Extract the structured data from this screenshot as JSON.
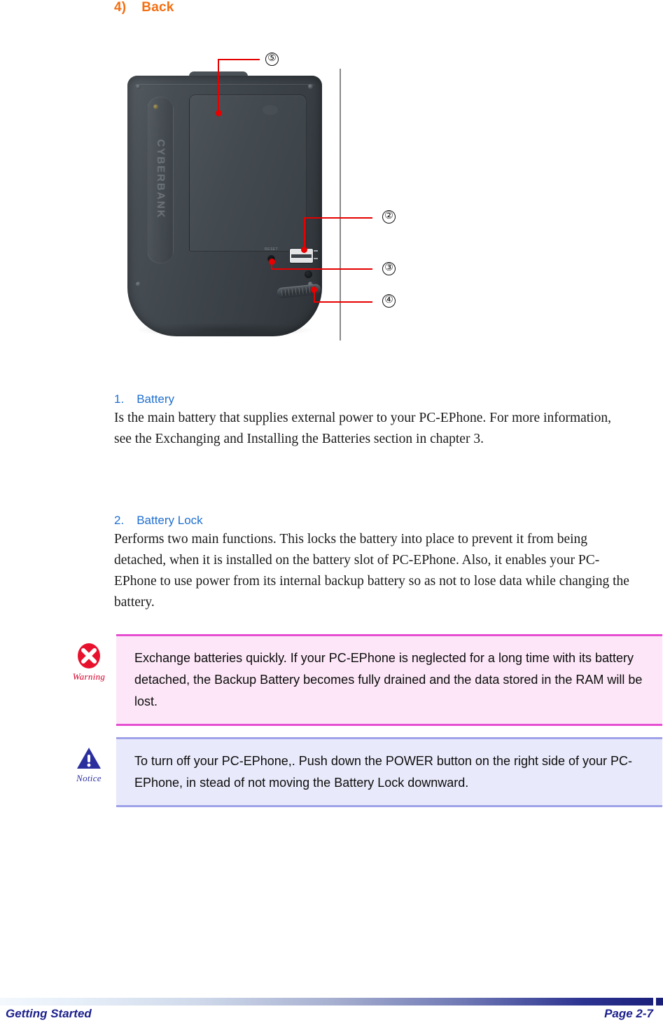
{
  "heading": {
    "number": "4)",
    "text": "Back"
  },
  "figure": {
    "alt": "Back view of the PC-EPhone device",
    "brand_emboss": "CYBERBANK",
    "reset_label": "RESET",
    "callouts": [
      {
        "id": "callout-5",
        "label": "⑤",
        "target": "battery-cover"
      },
      {
        "id": "callout-2",
        "label": "②",
        "target": "battery-lock-slider"
      },
      {
        "id": "callout-3",
        "label": "③",
        "target": "reset-hole"
      },
      {
        "id": "callout-4",
        "label": "④",
        "target": "battery-latch"
      }
    ]
  },
  "items": [
    {
      "number": "1.",
      "title": "Battery",
      "body": "Is the main battery that supplies external power to your PC-EPhone. For more information, see the Exchanging and Installing the Batteries section in chapter 3."
    },
    {
      "number": "2.",
      "title": "Battery Lock",
      "body": "Performs two main functions. This locks the battery into place to prevent it from being detached, when it is installed on the battery slot of PC-EPhone. Also, it enables your PC-EPhone to use power from its internal backup battery so as not to lose data while changing the battery."
    }
  ],
  "callout_boxes": [
    {
      "kind": "warning",
      "icon_name": "warning-x-icon",
      "caption": "Warning",
      "text": "Exchange batteries quickly. If your PC-EPhone is neglected for a long time with its battery detached, the Backup Battery becomes fully drained and the data stored in the RAM will be lost."
    },
    {
      "kind": "notice",
      "icon_name": "notice-exclamation-icon",
      "caption": "Notice",
      "text": "To turn off your PC-EPhone,. Push down the POWER button on the right side of your PC-EPhone, in stead of not moving the Battery Lock downward."
    }
  ],
  "footer": {
    "left": "Getting Started",
    "right": "Page 2-7"
  },
  "colors": {
    "heading_orange": "#F36F12",
    "item_title_blue": "#1F6FD0",
    "callout_red": "#E60000",
    "warning_bg": "#FCE6F7",
    "warning_border": "#E64FD1",
    "notice_bg": "#E8E9FA",
    "notice_border": "#9FA2E8",
    "footer_navy": "#1B1F8C"
  }
}
